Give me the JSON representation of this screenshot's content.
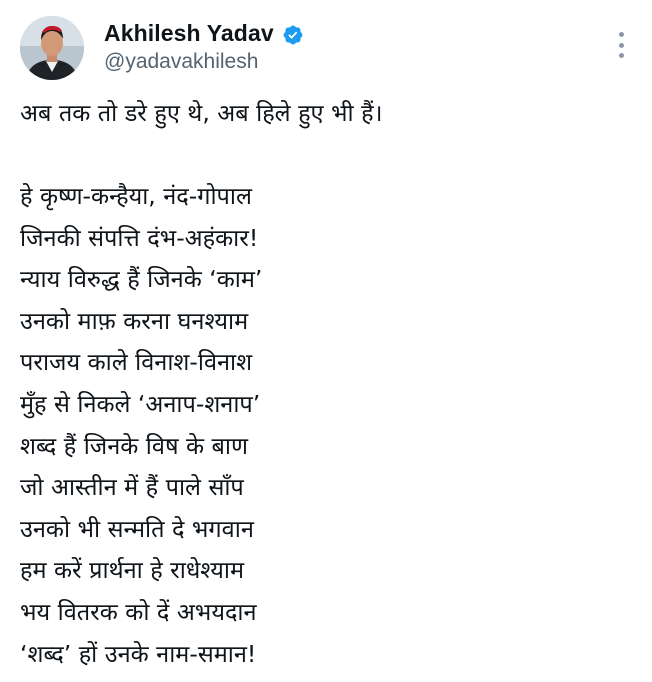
{
  "tweet": {
    "author": {
      "display_name": "Akhilesh Yadav",
      "handle": "@yadavakhilesh",
      "verified": true,
      "verified_icon": "verified-badge-icon",
      "avatar_icon": "profile-photo"
    },
    "more_icon": "more-options-icon",
    "text": {
      "first_line": "अब तक तो डरे हुए थे, अब हिले हुए भी हैं।",
      "poem": [
        "हे कृष्ण-कन्हैया, नंद-गोपाल",
        "जिनकी संपत्ति दंभ-अहंकार!",
        "न्याय विरुद्ध हैं जिनके ‘काम’",
        "उनको माफ़ करना घनश्याम",
        "पराजय काले विनाश-विनाश",
        "मुँह से निकले ‘अनाप-शनाप’",
        "शब्द हैं जिनके विष के बाण",
        "जो आस्तीन में हैं पाले साँप",
        "उनको भी सन्मति दे भगवान",
        "हम करें प्रार्थना हे राधेश्याम",
        "भय वितरक को दें अभयदान",
        "‘शब्द’ हों उनके नाम-समान!"
      ]
    }
  },
  "colors": {
    "text_primary": "#0f1419",
    "text_secondary": "#536471",
    "verified_blue": "#1d9bf0",
    "background": "#ffffff"
  }
}
